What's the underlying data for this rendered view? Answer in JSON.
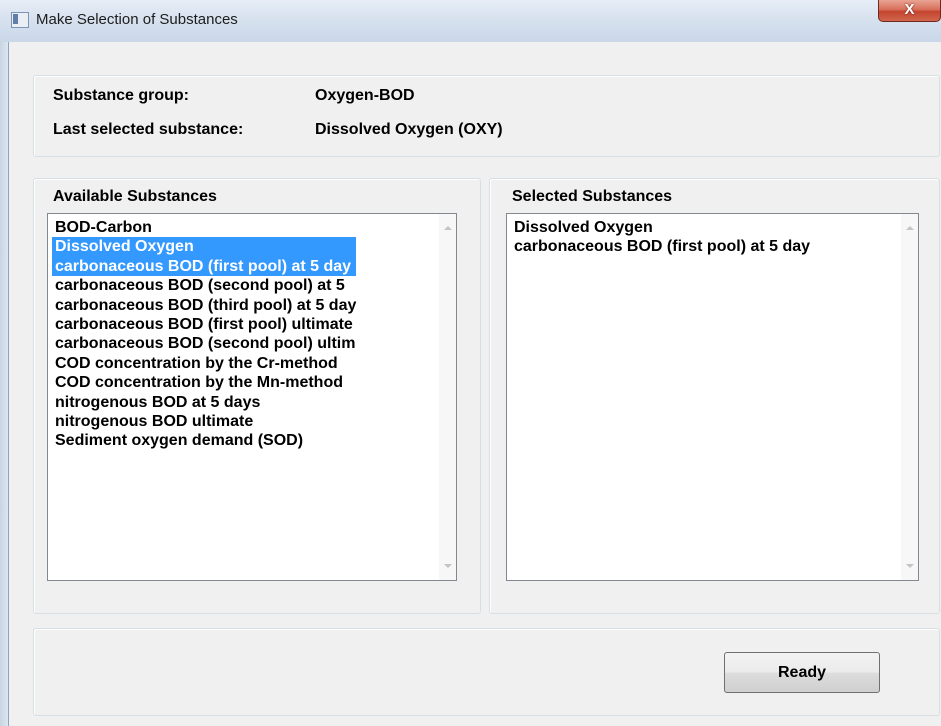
{
  "window": {
    "title": "Make Selection of Substances",
    "close_glyph": "X"
  },
  "info": {
    "group_label": "Substance group:",
    "group_value": "Oxygen-BOD",
    "last_label": "Last selected substance:",
    "last_value": "Dissolved Oxygen (OXY)"
  },
  "available": {
    "header": "Available Substances",
    "items": [
      "BOD-Carbon",
      "Dissolved Oxygen",
      "carbonaceous BOD (first pool) at 5 day",
      "carbonaceous BOD (second pool) at 5",
      "carbonaceous BOD (third pool) at 5 day",
      "carbonaceous BOD (first pool) ultimate",
      "carbonaceous BOD (second pool) ultim",
      "COD concentration by the Cr-method",
      "COD concentration by the Mn-method",
      "nitrogenous BOD at 5 days",
      "nitrogenous BOD ultimate",
      "Sediment oxygen demand (SOD)"
    ],
    "highlighted_items": [
      "Dissolved Oxygen",
      "carbonaceous BOD (first pool) at 5 day"
    ]
  },
  "selected": {
    "header": "Selected Substances",
    "items": [
      "Dissolved Oxygen",
      "carbonaceous BOD (first pool) at 5 day"
    ]
  },
  "buttons": {
    "ready": "Ready"
  },
  "colors": {
    "selection_bg": "#3399ff",
    "selection_fg": "#ffffff",
    "window_bg": "#f0f0f0",
    "close_button": "#c94a33"
  },
  "icons": {
    "window_icon": "app-window-icon",
    "close": "close-icon",
    "scroll_up": "scroll-up-arrow-icon",
    "scroll_down": "scroll-down-arrow-icon"
  }
}
